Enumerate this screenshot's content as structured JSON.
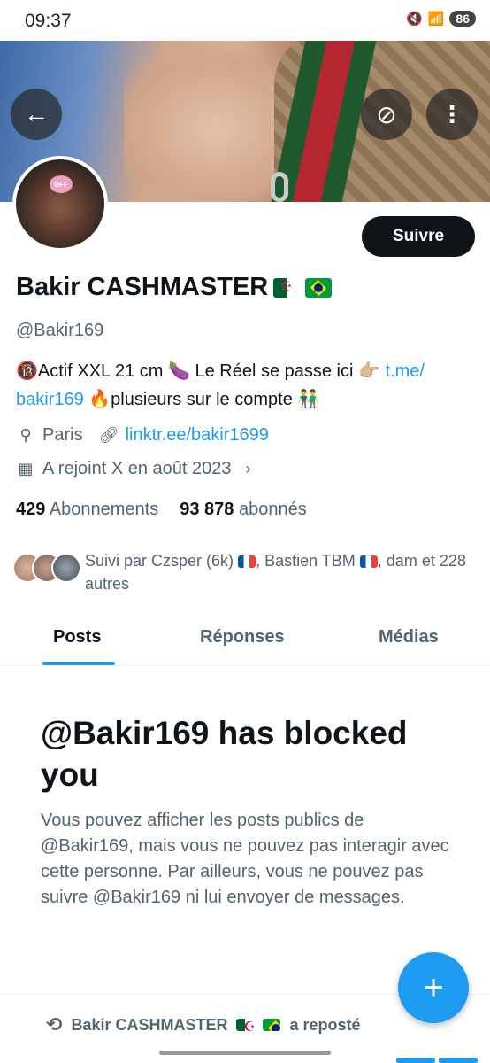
{
  "status": {
    "time": "09:37",
    "battery": "86"
  },
  "header": {
    "back_icon": "←",
    "grok_icon": "⊘",
    "more_icon": "⋮"
  },
  "profile": {
    "follow_label": "Suivre",
    "name": "Bakir CASHMASTER",
    "handle": "@Bakir169",
    "bio": {
      "part1": "🔞Actif XXL 21 cm 🍆 Le Réel se passe ici 👉🏼 ",
      "link": "t.me/\nbakir169",
      "part2": " 🔥plusieurs sur le compte 👬"
    },
    "location": "Paris",
    "website": "linktr.ee/bakir1699",
    "joined": "A rejoint X en août 2023",
    "following_count": "429",
    "following_label": "Abonnements",
    "followers_count": "93 878",
    "followers_label": "abonnés",
    "followed_by": {
      "prefix": "Suivi par Czsper (6k)",
      "mid": ", Bastien TBM",
      "suffix": ", dam et 228 autres"
    }
  },
  "tabs": [
    {
      "label": "Posts"
    },
    {
      "label": "Réponses"
    },
    {
      "label": "Médias"
    }
  ],
  "blocked": {
    "title": "@Bakir169 has blocked you",
    "body": "Vous pouvez afficher les posts publics de @Bakir169, mais vous ne pouvez pas interagir avec cette personne. Par ailleurs, vous ne pouvez pas suivre @Bakir169 ni lui envoyer de messages."
  },
  "repost": {
    "name": "Bakir CASHMASTER",
    "suffix": "a reposté"
  },
  "fab": {
    "icon": "+"
  },
  "colors": {
    "accent": "#1d9bf0",
    "text": "#0f1419",
    "muted": "#536471"
  }
}
